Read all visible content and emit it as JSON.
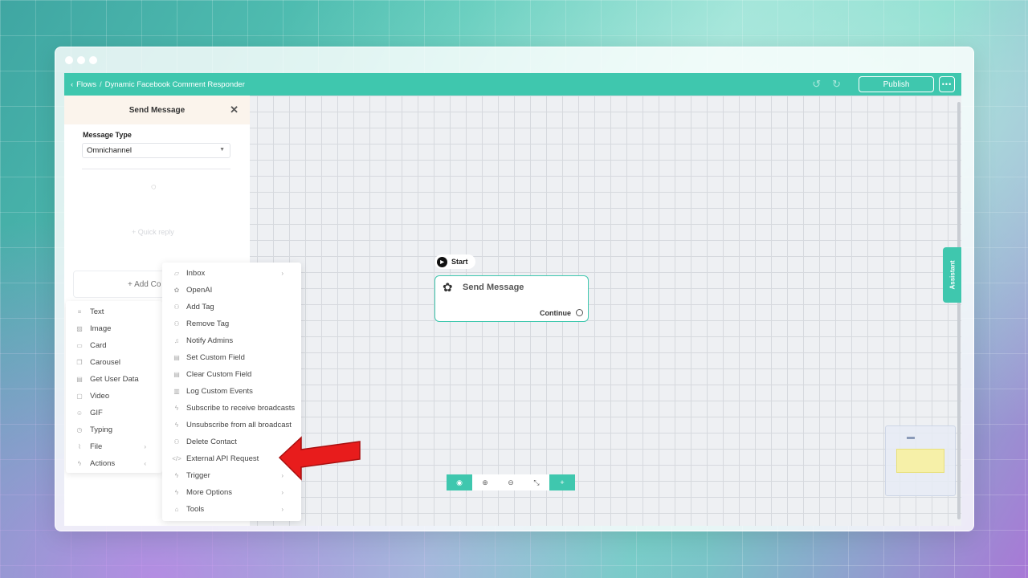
{
  "topbar": {
    "back_label": "Flows",
    "separator": "/",
    "flow_name": "Dynamic Facebook Comment Responder",
    "publish_label": "Publish",
    "more_label": "•••"
  },
  "panel": {
    "title": "Send Message",
    "message_type_label": "Message Type",
    "message_type_value": "Omnichannel",
    "quick_reply_label": "+ Quick reply",
    "add_content_label": "+ Add Co"
  },
  "content_menu": {
    "items": [
      {
        "label": "Text",
        "icon": "text-icon"
      },
      {
        "label": "Image",
        "icon": "image-icon"
      },
      {
        "label": "Card",
        "icon": "card-icon"
      },
      {
        "label": "Carousel",
        "icon": "carousel-icon"
      },
      {
        "label": "Get User Data",
        "icon": "user-data-icon"
      },
      {
        "label": "Video",
        "icon": "video-icon"
      },
      {
        "label": "GIF",
        "icon": "gif-icon"
      },
      {
        "label": "Typing",
        "icon": "clock-icon"
      },
      {
        "label": "File",
        "icon": "file-icon"
      },
      {
        "label": "Actions",
        "icon": "bolt-icon"
      }
    ]
  },
  "actions_menu": {
    "items": [
      {
        "label": "Inbox",
        "icon": "chat-icon"
      },
      {
        "label": "OpenAI",
        "icon": "openai-icon"
      },
      {
        "label": "Add Tag",
        "icon": "tag-icon"
      },
      {
        "label": "Remove Tag",
        "icon": "tag-icon"
      },
      {
        "label": "Notify Admins",
        "icon": "bell-icon"
      },
      {
        "label": "Set Custom Field",
        "icon": "field-icon"
      },
      {
        "label": "Clear Custom Field",
        "icon": "field-icon"
      },
      {
        "label": "Log Custom Events",
        "icon": "chart-icon"
      },
      {
        "label": "Subscribe to receive broadcasts",
        "icon": "bolt-icon"
      },
      {
        "label": "Unsubscribe from all broadcast",
        "icon": "bolt-icon"
      },
      {
        "label": "Delete Contact",
        "icon": "user-remove-icon"
      },
      {
        "label": "External API Request",
        "icon": "code-icon"
      },
      {
        "label": "Trigger",
        "icon": "bolt-icon"
      },
      {
        "label": "More Options",
        "icon": "bolt-icon"
      },
      {
        "label": "Tools",
        "icon": "tools-icon"
      }
    ]
  },
  "canvas": {
    "start_label": "Start",
    "node_title": "Send Message",
    "node_continue": "Continue",
    "assistant_label": "Assistant"
  },
  "colors": {
    "accent": "#3fc7ae",
    "highlight_arrow": "#e81c1c"
  }
}
